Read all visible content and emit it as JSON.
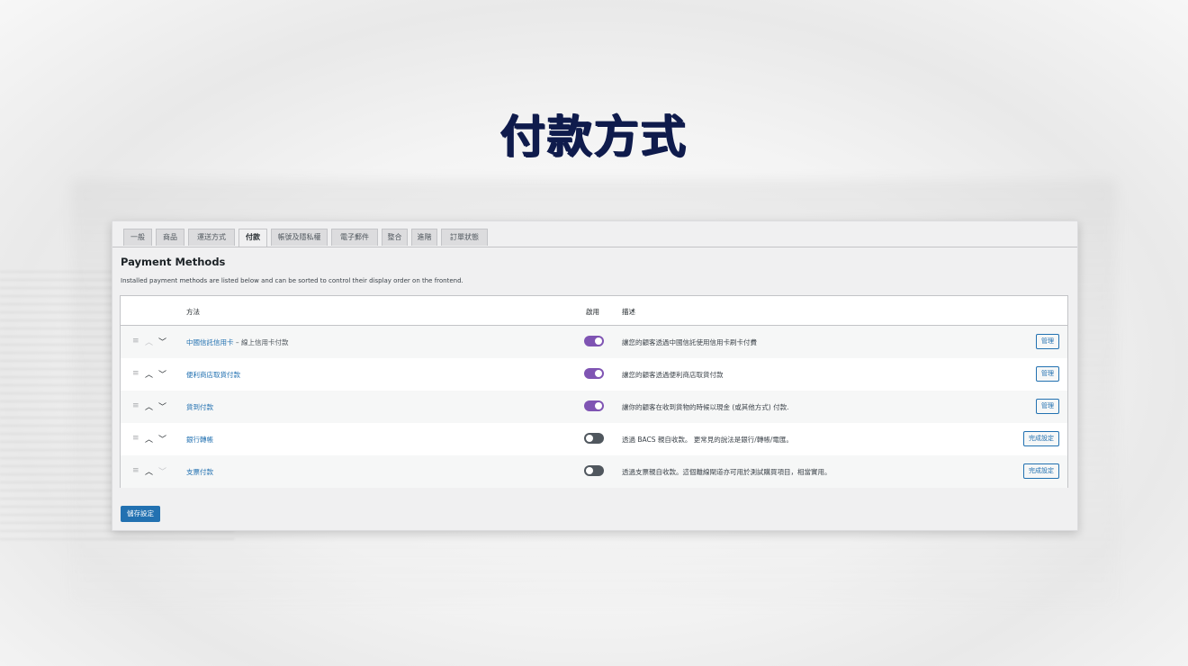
{
  "page": {
    "title": "付款方式"
  },
  "tabs": [
    {
      "label": "一般"
    },
    {
      "label": "商品"
    },
    {
      "label": "運送方式"
    },
    {
      "label": "付款",
      "active": true
    },
    {
      "label": "帳號及隱私權"
    },
    {
      "label": "電子郵件"
    },
    {
      "label": "整合"
    },
    {
      "label": "進階"
    },
    {
      "label": "訂單狀態"
    }
  ],
  "section": {
    "title": "Payment Methods",
    "description": "Installed payment methods are listed below and can be sorted to control their display order on the frontend."
  },
  "table": {
    "headers": {
      "method": "方法",
      "enabled": "啟用",
      "description": "描述"
    },
    "rows": [
      {
        "name": "中國信託信用卡",
        "suffix": " – 線上信用卡付款",
        "enabled": true,
        "description": "讓您的顧客透過中國信託使用信用卡刷卡付費",
        "action": "管理"
      },
      {
        "name": "便利商店取貨付款",
        "suffix": "",
        "enabled": true,
        "description": "讓您的顧客透過便利商店取貨付款",
        "action": "管理"
      },
      {
        "name": "貨到付款",
        "suffix": "",
        "enabled": true,
        "description": "讓你的顧客在收到貨物的時候以現金 (或其他方式) 付款.",
        "action": "管理"
      },
      {
        "name": "銀行轉帳",
        "suffix": "",
        "enabled": false,
        "description": "透過 BACS 親自收款。 更常見的說法是銀行/轉帳/電匯。",
        "action": "完成設定"
      },
      {
        "name": "支票付款",
        "suffix": "",
        "enabled": false,
        "description": "透過支票親自收款。這個離線閘道亦可用於測試購買項目，相當實用。",
        "action": "完成設定"
      }
    ]
  },
  "footer": {
    "save_label": "儲存設定"
  },
  "colors": {
    "accent": "#2271b1",
    "toggle_on": "#7f54b3",
    "title": "#0f1b4c"
  },
  "icons": {
    "drag": "drag-handle-icon",
    "up": "chevron-up-icon",
    "down": "chevron-down-icon"
  }
}
